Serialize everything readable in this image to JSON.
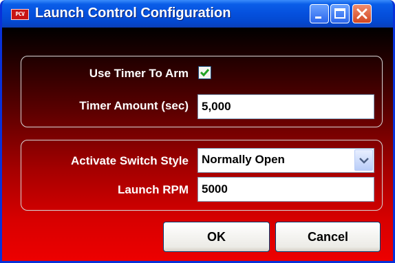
{
  "window": {
    "title": "Launch Control Configuration",
    "app_icon_text": "PCV",
    "controls": [
      "minimize",
      "maximize",
      "close"
    ]
  },
  "group1": {
    "use_timer_label": "Use Timer To Arm",
    "use_timer_checked": true,
    "timer_amount_label": "Timer Amount (sec)",
    "timer_amount_value": "5,000"
  },
  "group2": {
    "switch_style_label": "Activate Switch Style",
    "switch_style_value": "Normally Open",
    "launch_rpm_label": "Launch RPM",
    "launch_rpm_value": "5000"
  },
  "buttons": {
    "ok": "OK",
    "cancel": "Cancel"
  },
  "colors": {
    "titlebar": "#0550dd",
    "background_top": "#000000",
    "background_bottom": "#ee0000",
    "checkmark": "#21a121"
  },
  "icons": {
    "app": "pcv-logo-icon",
    "minimize": "minimize-icon",
    "maximize": "maximize-icon",
    "close": "close-icon",
    "dropdown": "chevron-down-icon",
    "check": "checkmark-icon"
  }
}
